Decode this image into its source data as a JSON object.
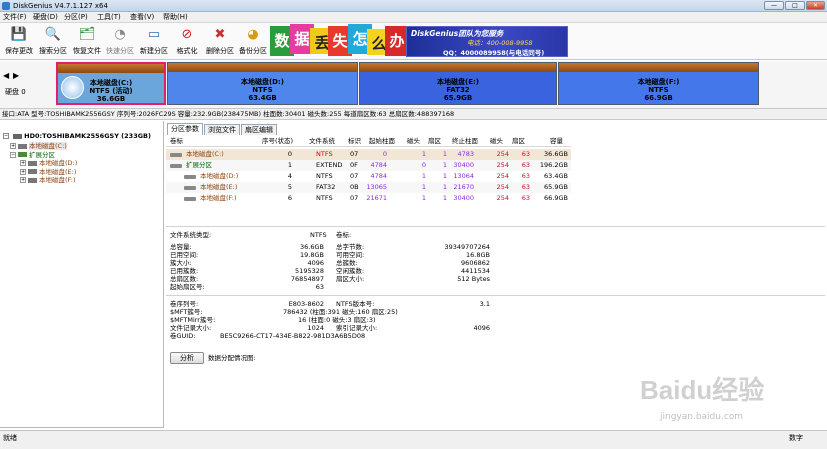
{
  "window": {
    "title": "DiskGenius V4.7.1.127 x64",
    "min": "—",
    "max": "□",
    "close": "✕"
  },
  "menu": [
    "文件(F)",
    "硬盘(D)",
    "分区(P)",
    "工具(T)",
    "查看(V)",
    "帮助(H)"
  ],
  "toolbar": [
    {
      "label": "保存更改",
      "icon": "save-icon",
      "glyph": "💾"
    },
    {
      "label": "搜索分区",
      "icon": "search-icon",
      "glyph": "🔍"
    },
    {
      "label": "恢复文件",
      "icon": "recover-icon",
      "glyph": "🗂"
    },
    {
      "label": "快速分区",
      "icon": "quick-partition-icon",
      "glyph": "◔"
    },
    {
      "label": "新建分区",
      "icon": "new-partition-icon",
      "glyph": "▭"
    },
    {
      "label": "格式化",
      "icon": "format-icon",
      "glyph": "⊘"
    },
    {
      "label": "删除分区",
      "icon": "delete-icon",
      "glyph": "✖"
    },
    {
      "label": "备份分区",
      "icon": "backup-icon",
      "glyph": "◕"
    }
  ],
  "banner": {
    "tiles": [
      "数",
      "据",
      "丢",
      "失",
      "怎",
      "么",
      "办"
    ],
    "brand": "DiskGenius团队为您服务",
    "tel": "电话：400-008-9958",
    "qq": "QQ：4000089958(与电话同号)"
  },
  "disk_nav": {
    "label": "硬盘 0",
    "prev": "◀",
    "next": "▶"
  },
  "partitions": [
    {
      "name": "本地磁盘(C:)",
      "fs": "NTFS (活动)",
      "size": "36.6GB",
      "share": 0.187,
      "color": "#6fa8dc",
      "selected": true
    },
    {
      "name": "本地磁盘(D:)",
      "fs": "NTFS",
      "size": "63.4GB",
      "share": 0.323,
      "color": "#4f86ec"
    },
    {
      "name": "本地磁盘(E:)",
      "fs": "FAT32",
      "size": "65.9GB",
      "share": 0.336,
      "color": "#3a63e0"
    },
    {
      "name": "本地磁盘(F:)",
      "fs": "NTFS",
      "size": "66.9GB",
      "share": 0.341,
      "color": "#4478ea"
    }
  ],
  "infobar": "接口:ATA  型号:TOSHIBAMK2556GSY  序列号:2026FC29S  容量:232.9GB(238475MB)  柱面数:30401  磁头数:255  每道扇区数:63  总扇区数:488397168",
  "tree": {
    "disk": "HD0:TOSHIBAMK2556GSY (233GB)",
    "items": [
      {
        "label": "本地磁盘(C:)",
        "indent": 1,
        "kind": "disk"
      },
      {
        "label": "扩展分区",
        "indent": 1,
        "kind": "ext"
      },
      {
        "label": "本地磁盘(D:)",
        "indent": 2,
        "kind": "disk"
      },
      {
        "label": "本地磁盘(E:)",
        "indent": 2,
        "kind": "disk"
      },
      {
        "label": "本地磁盘(F:)",
        "indent": 2,
        "kind": "disk"
      }
    ]
  },
  "tabs": [
    "分区参数",
    "浏览文件",
    "扇区编辑"
  ],
  "table": {
    "headers": [
      "卷标",
      "序号(状态)",
      "文件系统",
      "标识",
      "起始柱面",
      "磁头",
      "扇区",
      "终止柱面",
      "磁头",
      "扇区",
      "容量"
    ],
    "rows": [
      {
        "cells": [
          "本地磁盘(C:)",
          "0",
          "NTFS",
          "07",
          "0",
          "1",
          "1",
          "4783",
          "254",
          "63",
          "36.6GB"
        ],
        "indent": 1,
        "name_color": "#8b4513",
        "fs_color": "#d40000",
        "hl": true
      },
      {
        "cells": [
          "扩展分区",
          "1",
          "EXTEND",
          "0F",
          "4784",
          "0",
          "1",
          "30400",
          "254",
          "63",
          "196.2GB"
        ],
        "indent": 1,
        "name_color": "#006400",
        "fs_color": "#000000"
      },
      {
        "cells": [
          "本地磁盘(D:)",
          "4",
          "NTFS",
          "07",
          "4784",
          "1",
          "1",
          "13064",
          "254",
          "63",
          "63.4GB"
        ],
        "indent": 2,
        "name_color": "#8b4513",
        "fs_color": "#000000"
      },
      {
        "cells": [
          "本地磁盘(E:)",
          "5",
          "FAT32",
          "0B",
          "13065",
          "1",
          "1",
          "21670",
          "254",
          "63",
          "65.9GB"
        ],
        "indent": 2,
        "name_color": "#8b4513",
        "fs_color": "#000000"
      },
      {
        "cells": [
          "本地磁盘(F:)",
          "6",
          "NTFS",
          "07",
          "21671",
          "1",
          "1",
          "30400",
          "254",
          "63",
          "66.9GB"
        ],
        "indent": 2,
        "name_color": "#8b4513",
        "fs_color": "#000000"
      }
    ]
  },
  "details": {
    "fs_type_label": "文件系统类型:",
    "fs_type": "NTFS",
    "vol_label_label": "卷标:",
    "left": [
      [
        "总容量:",
        "36.6GB"
      ],
      [
        "已用空间:",
        "19.8GB"
      ],
      [
        "簇大小:",
        "4096"
      ],
      [
        "已用簇数:",
        "5195328"
      ],
      [
        "总扇区数:",
        "76854897"
      ],
      [
        "起始扇区号:",
        "63"
      ]
    ],
    "right": [
      [
        "总字节数:",
        "39349707264"
      ],
      [
        "可用空间:",
        "16.8GB"
      ],
      [
        "总簇数:",
        "9606862"
      ],
      [
        "空闲簇数:",
        "4411534"
      ],
      [
        "扇区大小:",
        "512 Bytes"
      ]
    ],
    "lower": [
      [
        "卷序列号:",
        "E803-8602",
        "NTFS版本号:",
        "3.1"
      ],
      [
        "$MFT簇号:",
        "786432 (柱面:391 磁头:160 扇区:25)",
        "",
        ""
      ],
      [
        "$MFTMirr簇号:",
        "16 (柱面:0 磁头:3 扇区:3)",
        "",
        ""
      ],
      [
        "文件记录大小:",
        "1024",
        "索引记录大小:",
        "4096"
      ],
      [
        "卷GUID:",
        "BE5C9266-CT17-434E-B822-981D3A6B5D08",
        "",
        ""
      ]
    ],
    "analyze_button": "分析",
    "alloc_label": "数据分配情况图:"
  },
  "watermark": {
    "brand": "Baidu经验",
    "url": "jingyan.baidu.com"
  },
  "status": {
    "left": "就绪",
    "right": "数字"
  }
}
